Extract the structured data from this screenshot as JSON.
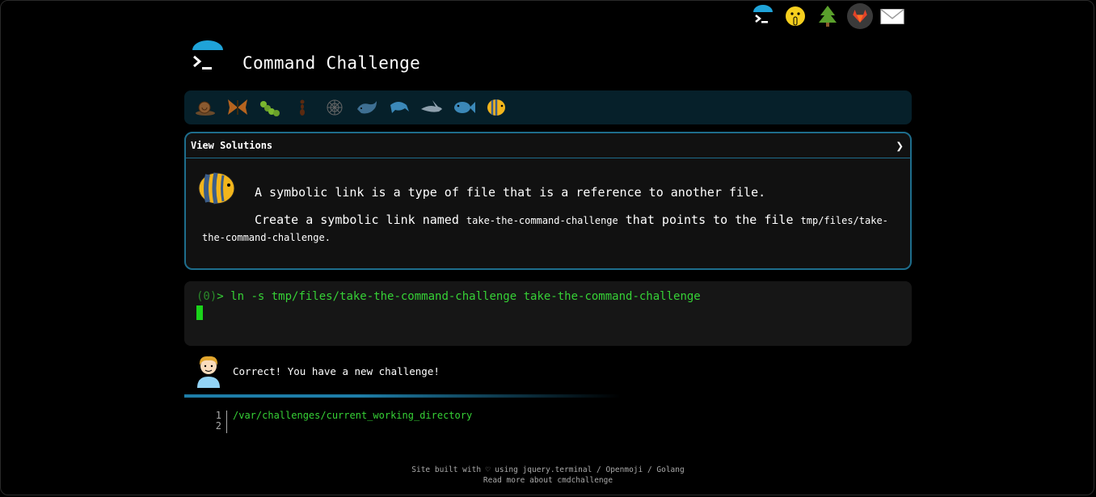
{
  "title": "Command Challenge",
  "top_icons": [
    "cmdchallenge-logo-icon",
    "shush-face-icon",
    "tree-icon",
    "gitlab-icon",
    "envelope-icon"
  ],
  "levels": [
    "snail-icon",
    "butterfly-icon",
    "caterpillar-icon",
    "ant-icon",
    "web-icon",
    "whale-icon",
    "dolphin-icon",
    "shark-icon",
    "fish-icon",
    "tropical-fish-icon"
  ],
  "challenge": {
    "view_solutions": "View Solutions",
    "chevron": "❯",
    "description_1": "A symbolic link is a type of file that is a reference to another file.",
    "desc2_a": "Create a symbolic link named ",
    "desc2_code1": "take-the-command-challenge",
    "desc2_b": " that points to the file ",
    "desc2_code2": "tmp/files/take-the-command-challenge",
    "desc2_c": "."
  },
  "terminal": {
    "prompt_status": "(0)",
    "prompt_symbol": "> ",
    "command": "ln -s tmp/files/take-the-command-challenge take-the-command-challenge"
  },
  "result": {
    "message": "Correct! You have a new challenge!"
  },
  "editor": {
    "line_numbers": [
      "1",
      "2"
    ],
    "line_1": "/var/challenges/current_working_directory"
  },
  "footer": {
    "line_1": "Site built with ♡ using jquery.terminal / Openmoji / Golang",
    "line_2": "Read more about cmdchallenge"
  }
}
